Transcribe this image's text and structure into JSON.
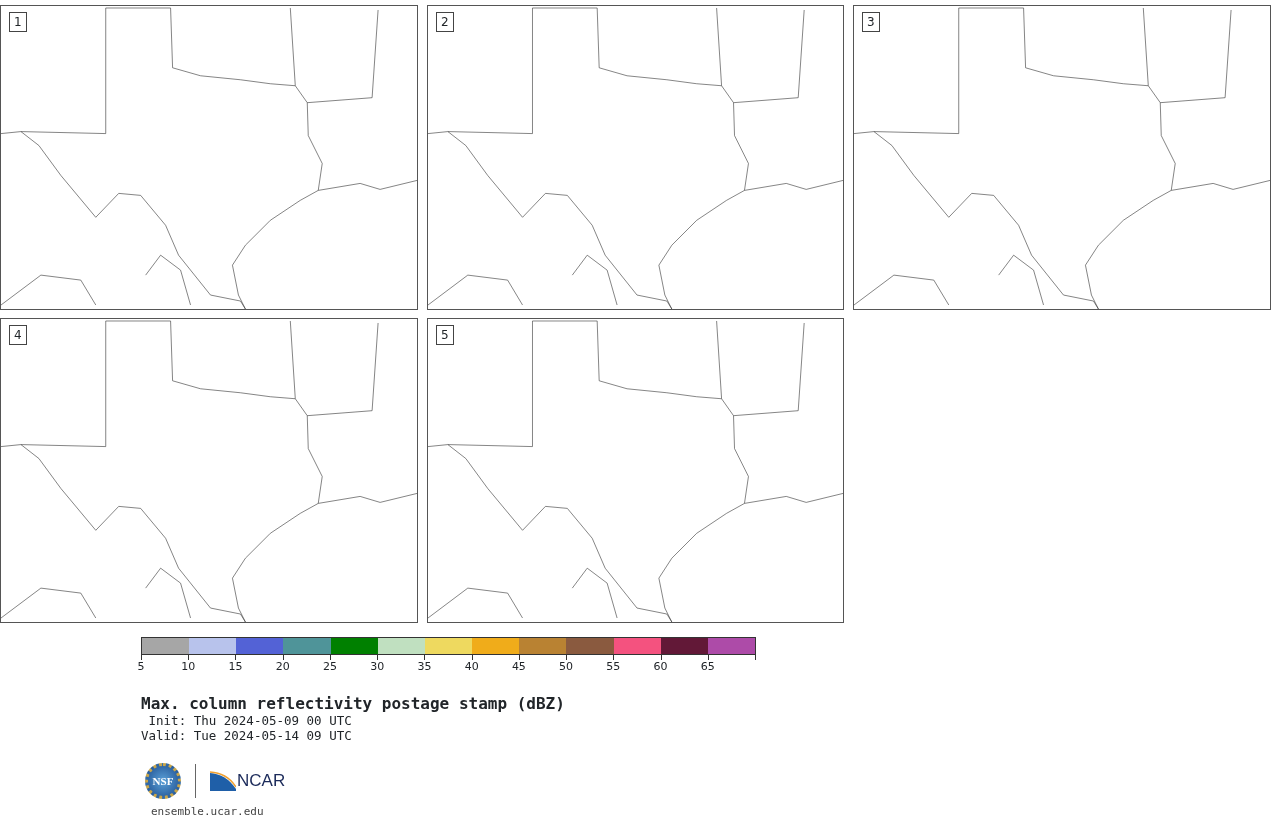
{
  "panels": [
    {
      "label": "1"
    },
    {
      "label": "2"
    },
    {
      "label": "3"
    },
    {
      "label": "4"
    },
    {
      "label": "5"
    }
  ],
  "colorbar": {
    "bins": [
      {
        "color": "#a6a6a6"
      },
      {
        "color": "#b8c3ec"
      },
      {
        "color": "#5362d6"
      },
      {
        "color": "#4f9499"
      },
      {
        "color": "#008000"
      },
      {
        "color": "#c0e0c0"
      },
      {
        "color": "#eed95f"
      },
      {
        "color": "#f0ac1a"
      },
      {
        "color": "#b98232"
      },
      {
        "color": "#8a5a3f"
      },
      {
        "color": "#f4527f"
      },
      {
        "color": "#621837"
      },
      {
        "color": "#ad4ba8"
      }
    ],
    "ticks": [
      "5",
      "10",
      "15",
      "20",
      "25",
      "30",
      "35",
      "40",
      "45",
      "50",
      "55",
      "60",
      "65"
    ]
  },
  "title": "Max. column reflectivity postage stamp (dBZ)",
  "init": " Init: Thu 2024-05-09 00 UTC",
  "valid": "Valid: Tue 2024-05-14 09 UTC",
  "logos": {
    "nsf": "NSF",
    "ncar": "NCAR"
  },
  "url": "ensemble.ucar.edu"
}
